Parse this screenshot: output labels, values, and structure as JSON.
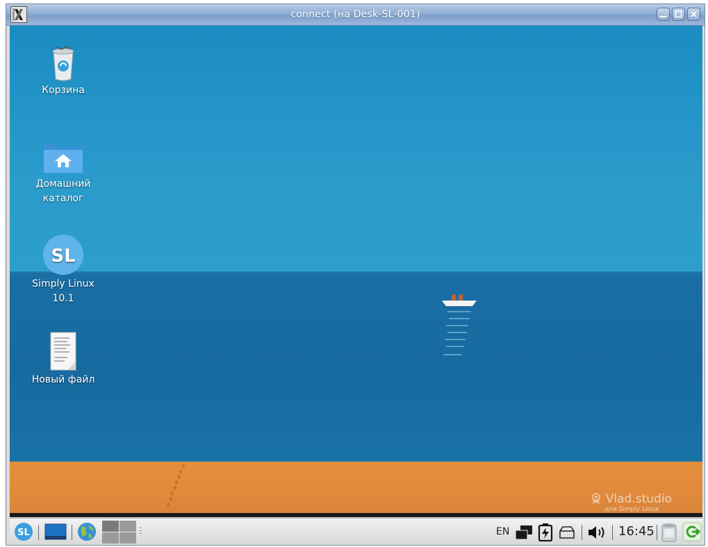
{
  "window": {
    "title": "connect (на Desk-SL-001)"
  },
  "desktop": {
    "icons": [
      {
        "label": "Корзина",
        "icon": "trash-icon"
      },
      {
        "label": "Домашний каталог",
        "icon": "home-folder-icon"
      },
      {
        "label": "Simply Linux 10.1",
        "icon": "simply-linux-icon"
      },
      {
        "label": "Новый файл",
        "icon": "text-file-icon"
      }
    ],
    "wallpaper": {
      "brand": "Vlad.studio",
      "tagline": "для Simply Linux"
    }
  },
  "taskbar": {
    "start_logo": "SL",
    "language": "EN",
    "clock": "16:45"
  },
  "colors": {
    "sky": "#2a9bcb",
    "sea": "#176aa0",
    "sand": "#e08a3a",
    "titlebar": "#8eaed6"
  }
}
